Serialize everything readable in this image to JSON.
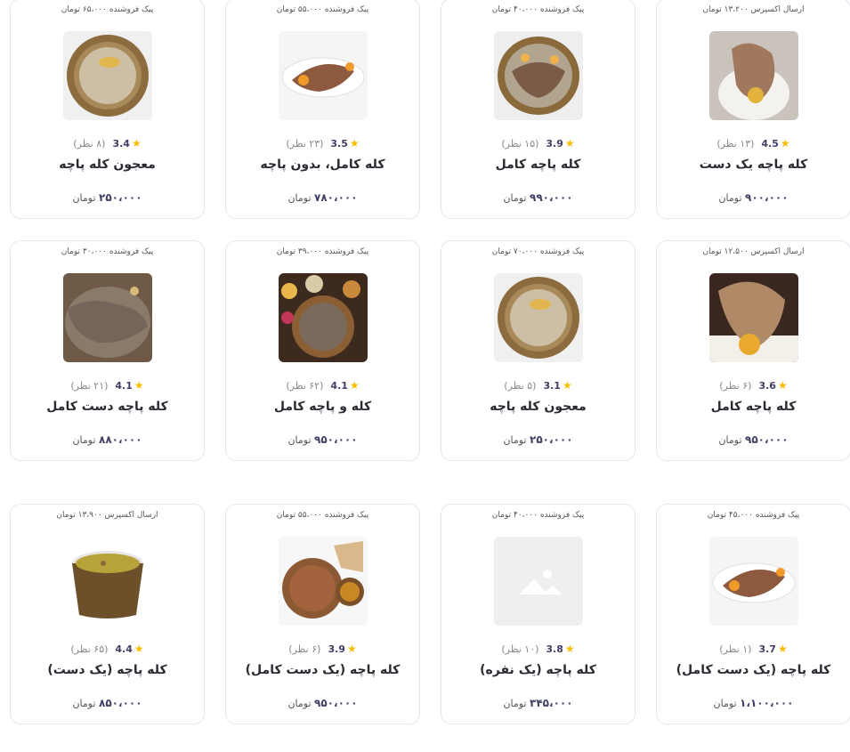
{
  "products": [
    {
      "delivery": "ارسال اکسپرس ۱۳،۲۰۰ تومان",
      "rating": "4.5",
      "reviews": "(۱۳ نظر)",
      "title": "کله پاچه یک دست",
      "price": "۹۰۰،۰۰۰",
      "currency": "تومان",
      "image": "pot-dish"
    },
    {
      "delivery": "پیک فروشنده ۴۰،۰۰۰ تومان",
      "rating": "3.9",
      "reviews": "(۱۵ نظر)",
      "title": "کله پاچه کامل",
      "price": "۹۹۰،۰۰۰",
      "currency": "تومان",
      "image": "platter-meat"
    },
    {
      "delivery": "پیک فروشنده ۵۵،۰۰۰ تومان",
      "rating": "3.5",
      "reviews": "(۲۳ نظر)",
      "title": "کله کامل، بدون پاچه",
      "price": "۷۸۰،۰۰۰",
      "currency": "تومان",
      "image": "oval-platter"
    },
    {
      "delivery": "پیک فروشنده ۶۵،۰۰۰ تومان",
      "rating": "3.4",
      "reviews": "(۸ نظر)",
      "title": "معجون کله پاچه",
      "price": "۲۵۰،۰۰۰",
      "currency": "تومان",
      "image": "copper-tray"
    },
    {
      "delivery": "ارسال اکسپرس ۱۲،۵۰۰ تومان",
      "rating": "3.6",
      "reviews": "(۶ نظر)",
      "title": "کله پاچه کامل",
      "price": "۹۵۰،۰۰۰",
      "currency": "تومان",
      "image": "head-closeup"
    },
    {
      "delivery": "پیک فروشنده ۷۰،۰۰۰ تومان",
      "rating": "3.1",
      "reviews": "(۵ نظر)",
      "title": "معجون کله پاچه",
      "price": "۲۵۰،۰۰۰",
      "currency": "تومان",
      "image": "copper-tray"
    },
    {
      "delivery": "پیک فروشنده ۳۹،۰۰۰ تومان",
      "rating": "4.1",
      "reviews": "(۶۲ نظر)",
      "title": "کله و پاچه کامل",
      "price": "۹۵۰،۰۰۰",
      "currency": "تومان",
      "image": "table-spread"
    },
    {
      "delivery": "پیک فروشنده ۳۰،۰۰۰ تومان",
      "rating": "4.1",
      "reviews": "(۲۱ نظر)",
      "title": "کله پاچه دست کامل",
      "price": "۸۸۰،۰۰۰",
      "currency": "تومان",
      "image": "tray-closeup"
    },
    {
      "delivery": "پیک فروشنده ۴۵،۰۰۰ تومان",
      "rating": "3.7",
      "reviews": "(۱ نظر)",
      "title": "کله پاچه (یک دست کامل)",
      "price": "۱،۱۰۰،۰۰۰",
      "currency": "تومان",
      "image": "oval-platter"
    },
    {
      "delivery": "پیک فروشنده ۴۰،۰۰۰ تومان",
      "rating": "3.8",
      "reviews": "(۱۰ نظر)",
      "title": "کله پاچه (یک نفره)",
      "price": "۳۴۵،۰۰۰",
      "currency": "تومان",
      "image": "placeholder"
    },
    {
      "delivery": "پیک فروشنده ۵۵،۰۰۰ تومان",
      "rating": "3.9",
      "reviews": "(۶ نظر)",
      "title": "کله پاچه (یک دست کامل)",
      "price": "۹۵۰،۰۰۰",
      "currency": "تومان",
      "image": "bowls-bread"
    },
    {
      "delivery": "ارسال اکسپرس ۱۳،۹۰۰ تومان",
      "rating": "4.4",
      "reviews": "(۶۵ نظر)",
      "title": "کله پاچه (یک دست)",
      "price": "۸۵۰،۰۰۰",
      "currency": "تومان",
      "image": "soup-container"
    }
  ],
  "colors": {
    "star": "#f9bc00",
    "text": "#3f4064",
    "border": "#e6e6ee"
  }
}
